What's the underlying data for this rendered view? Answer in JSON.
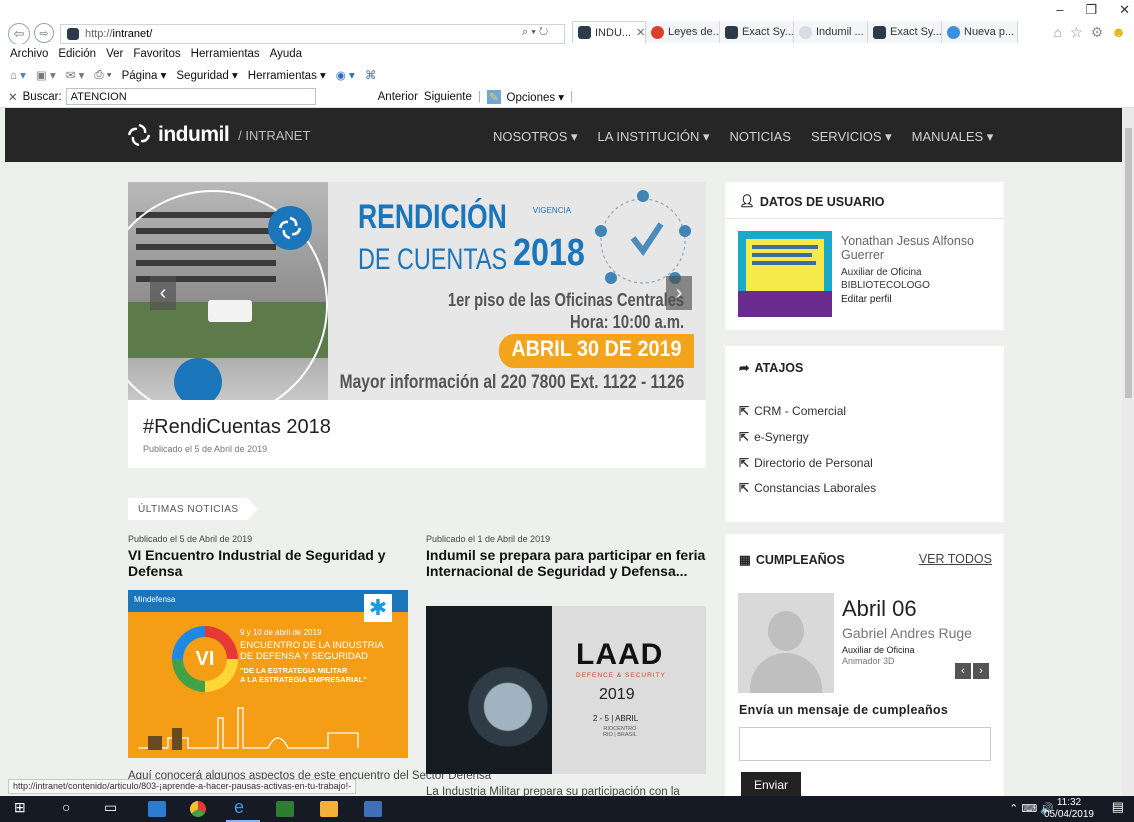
{
  "browser": {
    "window_controls": [
      "–",
      "❐",
      "✕"
    ],
    "address": {
      "prefix": "http://",
      "host": "intranet/"
    },
    "address_tools": "⌕ ▾ ↻",
    "tabs": [
      {
        "label": "INDU...",
        "close": "✕",
        "icon_color": "#2d3a4a",
        "active": true
      },
      {
        "label": "Leyes de...",
        "icon_color": "#d9412b"
      },
      {
        "label": "Exact Sy...",
        "icon_color": "#2d3a4a"
      },
      {
        "label": "Indumil ...",
        "icon_color": "#d8dde3"
      },
      {
        "label": "Exact Sy...",
        "icon_color": "#2d3a4a"
      },
      {
        "label": "Nueva p...",
        "icon_color": "#3e8ede"
      }
    ],
    "menu": [
      "Archivo",
      "Edición",
      "Ver",
      "Favoritos",
      "Herramientas",
      "Ayuda"
    ],
    "command": [
      "Página ▾",
      "Seguridad ▾",
      "Herramientas ▾"
    ],
    "find": {
      "close": "✕",
      "label": "Buscar:",
      "value": "ATENCION",
      "previous": "Anterior",
      "next": "Siguiente",
      "options": "Opciones ▾"
    },
    "status_url": "http://intranet/contenido/articulo/803-¡aprende-a-hacer-pausas-activas-en-tu-trabajo!-"
  },
  "site": {
    "brand": "indumil",
    "brand_sub": "/ INTRANET",
    "menu": [
      "NOSOTROS ▾",
      "LA INSTITUCIÓN ▾",
      "NOTICIAS",
      "SERVICIOS ▾",
      "MANUALES ▾"
    ],
    "hero": {
      "title_line1": "RENDICIÓN",
      "title_small": "VIGENCIA",
      "title_line2": "DE CUENTAS",
      "year": "2018",
      "place": "1er piso de las Oficinas Centrales",
      "time": "Hora: 10:00 a.m.",
      "date": "ABRIL 30 DE 2019",
      "info": "Mayor información al 220 7800 Ext. 1122 - 1126",
      "caption_title": "#RendiCuentas 2018",
      "caption_date": "Publicado el 5 de Abril de 2019",
      "prev": "‹",
      "next": "›"
    },
    "news_tag": "ÚLTIMAS NOTICIAS",
    "news": [
      {
        "date": "Publicado el 5 de Abril de 2019",
        "title": "VI Encuentro Industrial de Seguridad y Defensa",
        "img_org": "Mindefensa",
        "img_days": "9 y 10 de abril de 2019",
        "img_l1": "ENCUENTRO DE LA INDUSTRIA",
        "img_l2": "DE DEFENSA Y SEGURIDAD",
        "img_l3": "\"DE LA ESTRATEGIA MILITAR",
        "img_l4": "A LA ESTRATEGIA EMPRESARIAL\"",
        "img_badge": "VI",
        "excerpt": "Aquí conocerá algunos aspectos de este encuentro del Sector Defensa"
      },
      {
        "date": "Publicado el 1 de Abril de 2019",
        "title": "Indumil se prepara para participar en feria Internacional de Seguridad y Defensa...",
        "img_brand": "LAAD",
        "img_sub": "DEFENCE & SECURITY",
        "img_year": "2019",
        "img_days": "2 - 5 | ABRIL",
        "img_place1": "RIOCENTRO",
        "img_place2": "RIO | BRASIL",
        "excerpt": "La Industria Militar prepara su participación con la"
      }
    ],
    "user": {
      "heading": "DATOS DE USUARIO",
      "name": "Yonathan Jesus Alfonso Guerrer",
      "role": "Auxiliar de Oficina",
      "dept": "BIBLIOTECOLOGO",
      "edit": "Editar perfil"
    },
    "shortcuts": {
      "heading": "ATAJOS",
      "items": [
        "CRM - Comercial",
        "e-Synergy",
        "Directorio de Personal",
        "Constancias Laborales"
      ]
    },
    "birthdays": {
      "heading": "CUMPLEAÑOS",
      "see_all": "VER TODOS",
      "date": "Abril 06",
      "name": "Gabriel Andres Ruge",
      "role": "Auxiliar de Oficina",
      "dept": "Animador 3D",
      "prev": "‹",
      "next": "›",
      "message_label": "Envía un mensaje de cumpleaños",
      "send": "Enviar"
    }
  },
  "taskbar": {
    "clock_time": "11:32",
    "clock_date": "05/04/2019",
    "tray": "⌃ ⌨ 🔊"
  },
  "colors": {
    "nav_bg": "#262626",
    "brand_blue": "#1b75bb",
    "accent_orange": "#f4a41c",
    "page_bg": "#eef0ee"
  }
}
